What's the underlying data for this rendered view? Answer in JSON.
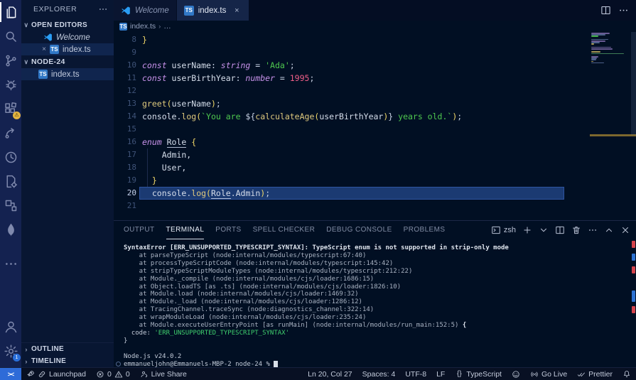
{
  "colors": {
    "accent_blue": "#2e6bd8",
    "ts_icon_blue": "#3178c6",
    "warning_badge_yellow": "#e2b340",
    "terminal_mark_red": "#d5444c",
    "terminal_mark_blue": "#2d72d2",
    "string_green": "#4fc94f",
    "keyword_purple": "#c792ea",
    "number_pink": "#ef5e88",
    "function_gold": "#dfc97e"
  },
  "activity_bar": {
    "top": [
      {
        "name": "explorer",
        "icon": "files-icon",
        "active": true
      },
      {
        "name": "search",
        "icon": "search-icon"
      },
      {
        "name": "source-control",
        "icon": "source-control-icon"
      },
      {
        "name": "run-debug",
        "icon": "debug-icon"
      },
      {
        "name": "extensions",
        "icon": "extensions-icon",
        "badge": "warn",
        "badge_text": "⚠"
      },
      {
        "name": "gitlens",
        "icon": "gitlens-icon"
      },
      {
        "name": "git-history",
        "icon": "clock-icon"
      },
      {
        "name": "remote-tools",
        "icon": "file-gear-icon"
      },
      {
        "name": "project-manager",
        "icon": "boxes-icon"
      },
      {
        "name": "mongodb",
        "icon": "mongodb-leaf-icon"
      },
      {
        "name": "more-views",
        "icon": "ellipsis-icon",
        "gap": true
      }
    ],
    "bottom": [
      {
        "name": "accounts",
        "icon": "account-icon"
      },
      {
        "name": "settings",
        "icon": "gear-icon",
        "badge": "num",
        "badge_text": "1"
      }
    ]
  },
  "sidebar": {
    "title": "EXPLORER",
    "title_action_icon": "ellipsis-icon",
    "open_editors": {
      "label": "OPEN EDITORS",
      "chevron": "∨",
      "items": [
        {
          "label": "Welcome",
          "icon": "vscode-logo-icon",
          "italic": true,
          "selected": false,
          "closable": false
        },
        {
          "label": "index.ts",
          "icon": "ts-file-icon",
          "italic": false,
          "selected": true,
          "closable": true,
          "close_glyph": "×"
        }
      ]
    },
    "folder": {
      "label": "NODE-24",
      "chevron": "∨",
      "items": [
        {
          "label": "index.ts",
          "icon": "ts-file-icon",
          "selected": true
        }
      ]
    },
    "bottom_sections": [
      {
        "label": "OUTLINE",
        "chevron": "›"
      },
      {
        "label": "TIMELINE",
        "chevron": "›"
      }
    ]
  },
  "tabs": [
    {
      "label": "Welcome",
      "icon": "vscode-logo-icon",
      "italic": true,
      "active": false,
      "closable": false
    },
    {
      "label": "index.ts",
      "icon": "ts-file-icon",
      "italic": false,
      "active": true,
      "closable": true,
      "close_glyph": "×"
    }
  ],
  "editor_actions": [
    {
      "name": "split-editor",
      "icon": "split-panel-icon"
    },
    {
      "name": "more-actions",
      "icon": "ellipsis-icon"
    }
  ],
  "breadcrumb": {
    "file_icon": "ts-file-icon",
    "items": [
      "index.ts",
      "…"
    ],
    "separator": "›"
  },
  "editor": {
    "first_line_number": 8,
    "active_line": 20,
    "lines": [
      {
        "num": 8,
        "tokens": [
          [
            "}",
            "b"
          ]
        ]
      },
      {
        "num": 9,
        "tokens": []
      },
      {
        "num": 10,
        "tokens": [
          [
            "const ",
            "kw"
          ],
          [
            "userName",
            "v"
          ],
          [
            ": ",
            "p"
          ],
          [
            "string",
            "ty"
          ],
          [
            " = ",
            "p"
          ],
          [
            "'Ada'",
            "s"
          ],
          [
            ";",
            "p"
          ]
        ]
      },
      {
        "num": 11,
        "tokens": [
          [
            "const ",
            "kw"
          ],
          [
            "userBirthYear",
            "v"
          ],
          [
            ": ",
            "p"
          ],
          [
            "number",
            "ty"
          ],
          [
            " = ",
            "p"
          ],
          [
            "1995",
            "n"
          ],
          [
            ";",
            "p"
          ]
        ]
      },
      {
        "num": 12,
        "tokens": []
      },
      {
        "num": 13,
        "tokens": [
          [
            "greet",
            "f"
          ],
          [
            "(",
            "b"
          ],
          [
            "userName",
            "v"
          ],
          [
            ")",
            "b"
          ],
          [
            ";",
            "p"
          ]
        ]
      },
      {
        "num": 14,
        "tokens": [
          [
            "console",
            "v"
          ],
          [
            ".",
            "p"
          ],
          [
            "log",
            "f"
          ],
          [
            "(",
            "b"
          ],
          [
            "`You are ",
            "s"
          ],
          [
            "${",
            "p"
          ],
          [
            "calculateAge",
            "f"
          ],
          [
            "(",
            "b"
          ],
          [
            "userBirthYear",
            "v"
          ],
          [
            ")",
            "b"
          ],
          [
            "}",
            "p"
          ],
          [
            " years old.`",
            "s"
          ],
          [
            ")",
            "b"
          ],
          [
            ";",
            "p"
          ]
        ]
      },
      {
        "num": 15,
        "tokens": []
      },
      {
        "num": 16,
        "tokens": [
          [
            "enum ",
            "kw"
          ],
          [
            "Role",
            "u"
          ],
          [
            " ",
            "p"
          ],
          [
            "{",
            "b"
          ]
        ]
      },
      {
        "num": 17,
        "tokens": [
          [
            "    Admin,",
            "v"
          ]
        ]
      },
      {
        "num": 18,
        "tokens": [
          [
            "    User,",
            "v"
          ]
        ]
      },
      {
        "num": 19,
        "tokens": [
          [
            "  }",
            "b"
          ]
        ]
      },
      {
        "num": 20,
        "tokens": [
          [
            "  ",
            "p"
          ],
          [
            "console",
            "v"
          ],
          [
            ".",
            "p"
          ],
          [
            "log",
            "f"
          ],
          [
            "(",
            "b"
          ],
          [
            "Role",
            "u"
          ],
          [
            ".",
            "p"
          ],
          [
            "Admin",
            "v"
          ],
          [
            ")",
            "b"
          ],
          [
            ";",
            "p"
          ]
        ]
      },
      {
        "num": 21,
        "tokens": []
      }
    ]
  },
  "panel": {
    "tabs": [
      "OUTPUT",
      "TERMINAL",
      "PORTS",
      "SPELL CHECKER",
      "DEBUG CONSOLE",
      "PROBLEMS"
    ],
    "active_tab": "TERMINAL",
    "actions": [
      {
        "name": "shell-select",
        "icon": "terminal-icon",
        "label": "zsh"
      },
      {
        "name": "new-terminal",
        "icon": "plus-icon"
      },
      {
        "name": "launch-profile-dropdown",
        "icon": "chevron-down-icon"
      },
      {
        "name": "split-terminal",
        "icon": "split-panel-icon"
      },
      {
        "name": "kill-terminal",
        "icon": "trash-icon"
      },
      {
        "name": "more-actions",
        "icon": "ellipsis-icon"
      },
      {
        "name": "maximize-panel",
        "icon": "chevron-up-icon"
      },
      {
        "name": "close-panel",
        "icon": "close-x-icon"
      }
    ],
    "terminal_lines": [
      {
        "segments": [
          [
            "SyntaxError [ERR_UNSUPPORTED_TYPESCRIPT_SYNTAX]: TypeScript enum is not supported in strip-only mode",
            "bold"
          ]
        ]
      },
      {
        "segments": [
          [
            "    at parseTypeScript (node:internal/modules/typescript:67:40)",
            "dim"
          ]
        ]
      },
      {
        "segments": [
          [
            "    at processTypeScriptCode (node:internal/modules/typescript:145:42)",
            "dim"
          ]
        ]
      },
      {
        "segments": [
          [
            "    at stripTypeScriptModuleTypes (node:internal/modules/typescript:212:22)",
            "dim"
          ]
        ]
      },
      {
        "segments": [
          [
            "    at Module._compile (node:internal/modules/cjs/loader:1686:15)",
            "dim"
          ]
        ]
      },
      {
        "segments": [
          [
            "    at Object.loadTS [as .ts] (node:internal/modules/cjs/loader:1826:10)",
            "dim"
          ]
        ]
      },
      {
        "segments": [
          [
            "    at Module.load (node:internal/modules/cjs/loader:1469:32)",
            "dim"
          ]
        ]
      },
      {
        "segments": [
          [
            "    at Module._load (node:internal/modules/cjs/loader:1286:12)",
            "dim"
          ]
        ]
      },
      {
        "segments": [
          [
            "    at TracingChannel.traceSync (node:diagnostics_channel:322:14)",
            "dim"
          ]
        ]
      },
      {
        "segments": [
          [
            "    at wrapModuleLoad (node:internal/modules/cjs/loader:235:24)",
            "dim"
          ]
        ]
      },
      {
        "segments": [
          [
            "    at Module.executeUserEntryPoint [as runMain] (node:internal/modules/run_main:152:5) ",
            "dim"
          ],
          [
            "{",
            "bold"
          ]
        ]
      },
      {
        "segments": [
          [
            "  code: ",
            "plain"
          ],
          [
            "'ERR_UNSUPPORTED_TYPESCRIPT_SYNTAX'",
            "green"
          ]
        ]
      },
      {
        "segments": [
          [
            "}",
            "plain"
          ]
        ]
      },
      {
        "segments": [
          [
            "",
            "plain"
          ]
        ]
      },
      {
        "segments": [
          [
            "Node.js v24.0.2",
            "plain"
          ]
        ]
      },
      {
        "prompt": true,
        "segments": [
          [
            "emmanueljohn@Emmanuels-MBP-2 node-24 % ",
            "plain"
          ]
        ]
      }
    ]
  },
  "status_bar": {
    "remote": {
      "name": "remote-indicator",
      "label": "><"
    },
    "left": [
      {
        "name": "launchpad",
        "parts": [
          [
            "icon",
            "rocket-icon"
          ],
          [
            "icon",
            "link-icon"
          ],
          [
            "text",
            "Launchpad"
          ]
        ]
      },
      {
        "name": "problems",
        "parts": [
          [
            "icon",
            "error-circle-icon"
          ],
          [
            "text",
            "0"
          ],
          [
            "icon",
            "warning-triangle-icon"
          ],
          [
            "text",
            "0"
          ]
        ]
      },
      {
        "name": "live-share",
        "parts": [
          [
            "icon",
            "live-share-icon"
          ],
          [
            "text",
            "Live Share"
          ]
        ]
      }
    ],
    "right": [
      {
        "name": "cursor-position",
        "parts": [
          [
            "text",
            "Ln 20, Col 27"
          ]
        ]
      },
      {
        "name": "indentation",
        "parts": [
          [
            "text",
            "Spaces: 4"
          ]
        ]
      },
      {
        "name": "encoding",
        "parts": [
          [
            "text",
            "UTF-8"
          ]
        ]
      },
      {
        "name": "eol",
        "parts": [
          [
            "text",
            "LF"
          ]
        ]
      },
      {
        "name": "language-mode",
        "parts": [
          [
            "icon",
            "braces-icon"
          ],
          [
            "text",
            "TypeScript"
          ]
        ]
      },
      {
        "name": "feedback",
        "parts": [
          [
            "icon",
            "smiley-icon"
          ]
        ]
      },
      {
        "name": "go-live",
        "parts": [
          [
            "icon",
            "broadcast-icon"
          ],
          [
            "text",
            "Go Live"
          ]
        ]
      },
      {
        "name": "prettier",
        "parts": [
          [
            "icon",
            "double-check-icon"
          ],
          [
            "text",
            "Prettier"
          ]
        ]
      },
      {
        "name": "notifications",
        "parts": [
          [
            "icon",
            "bell-icon"
          ]
        ]
      }
    ]
  }
}
